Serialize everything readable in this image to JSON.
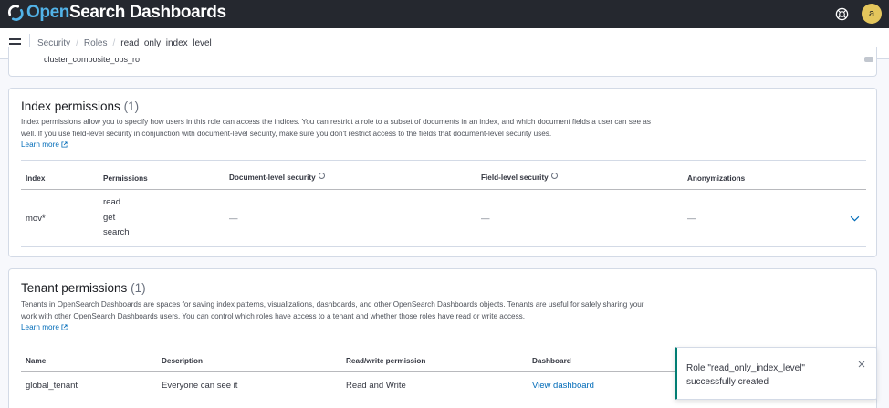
{
  "header": {
    "brand_open": "Open",
    "brand_rest": "Search Dashboards",
    "help_icon": "help-icon",
    "avatar_letter": "a",
    "avatar_color": "#e4c65c"
  },
  "breadcrumb": {
    "items": [
      "Security",
      "Roles"
    ],
    "current": "read_only_index_level",
    "separator": "/"
  },
  "top_clipped": {
    "text": "cluster_composite_ops_ro"
  },
  "index_permissions": {
    "title": "Index permissions",
    "count": "(1)",
    "description": "Index permissions allow you to specify how users in this role can access the indices. You can restrict a role to a subset of documents in an index, and which document fields a user can see as well. If you use field-level security in conjunction with document-level security, make sure you don't restrict access to the fields that document-level security uses.",
    "learn_more": "Learn more",
    "columns": [
      "Index",
      "Permissions",
      "Document-level security",
      "Field-level security",
      "Anonymizations"
    ],
    "rows": [
      {
        "index": "mov*",
        "permissions": [
          "read",
          "get",
          "search"
        ],
        "dls": "—",
        "fls": "—",
        "anonymizations": "—"
      }
    ]
  },
  "tenant_permissions": {
    "title": "Tenant permissions",
    "count": "(1)",
    "description": "Tenants in OpenSearch Dashboards are spaces for saving index patterns, visualizations, dashboards, and other OpenSearch Dashboards objects. Tenants are useful for safely sharing your work with other OpenSearch Dashboards users. You can control which roles have access to a tenant and whether those roles have read or write access.",
    "learn_more": "Learn more",
    "columns": [
      "Name",
      "Description",
      "Read/write permission",
      "Dashboard"
    ],
    "rows": [
      {
        "name": "global_tenant",
        "description": "Everyone can see it",
        "permission": "Read and Write",
        "dashboard_link": "View dashboard"
      }
    ]
  },
  "toast": {
    "message": "Role \"read_only_index_level\" successfully created",
    "color": "#017d73"
  }
}
